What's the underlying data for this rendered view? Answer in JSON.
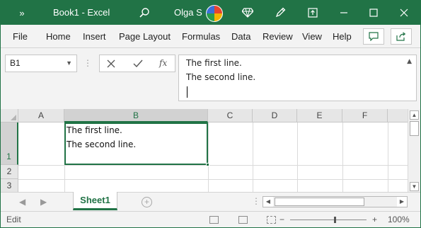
{
  "title_bar": {
    "quick_access_icon": "chevron-double-right-icon",
    "workbook_title": "Book1  -  Excel",
    "user_name": "Olga S",
    "icons": [
      "search-icon",
      "diamond-icon",
      "pen-icon",
      "ribbon-display-icon",
      "minimize-icon",
      "maximize-icon",
      "close-icon"
    ],
    "color": "#217346"
  },
  "ribbon": {
    "tabs": [
      "File",
      "Home",
      "Insert",
      "Page Layout",
      "Formulas",
      "Data",
      "Review",
      "View",
      "Help"
    ],
    "comment_icon": "comment-icon",
    "share_icon": "share-icon"
  },
  "formula_bar": {
    "name_box": "B1",
    "cancel_icon": "cancel-x-icon",
    "enter_icon": "check-icon",
    "fx_label": "fx",
    "content_lines": [
      "The first line.",
      "The second line."
    ]
  },
  "grid": {
    "columns": [
      "A",
      "B",
      "C",
      "D",
      "E",
      "F"
    ],
    "rows": [
      "1",
      "2",
      "3"
    ],
    "selected_cell": "B1",
    "cell_b1_lines": [
      "The first line.",
      "The second line."
    ]
  },
  "sheet_tabs": {
    "active_sheet": "Sheet1",
    "add_sheet_label": "+"
  },
  "status_bar": {
    "mode": "Edit",
    "zoom_minus": "−",
    "zoom_plus": "+",
    "zoom": "100%"
  }
}
